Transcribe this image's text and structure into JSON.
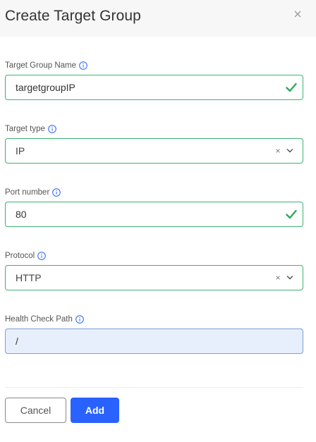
{
  "modal": {
    "title": "Create Target Group"
  },
  "fields": {
    "target_group_name": {
      "label": "Target Group Name",
      "value": "targetgroupIP"
    },
    "target_type": {
      "label": "Target type",
      "value": "IP"
    },
    "port_number": {
      "label": "Port number",
      "value": "80"
    },
    "protocol": {
      "label": "Protocol",
      "value": "HTTP"
    },
    "health_check_path": {
      "label": "Health Check Path",
      "value": "/"
    }
  },
  "buttons": {
    "cancel": "Cancel",
    "add": "Add"
  },
  "icons": {
    "close": "close-icon",
    "info": "info-icon",
    "valid": "check-icon",
    "clear": "clear-icon",
    "dropdown": "chevron-down-icon"
  },
  "colors": {
    "valid_border": "#3cb371",
    "focus_border": "#7b9fd6",
    "focus_bg": "#e8effc",
    "primary": "#2962ff",
    "header_bg": "#f7f7f7"
  }
}
